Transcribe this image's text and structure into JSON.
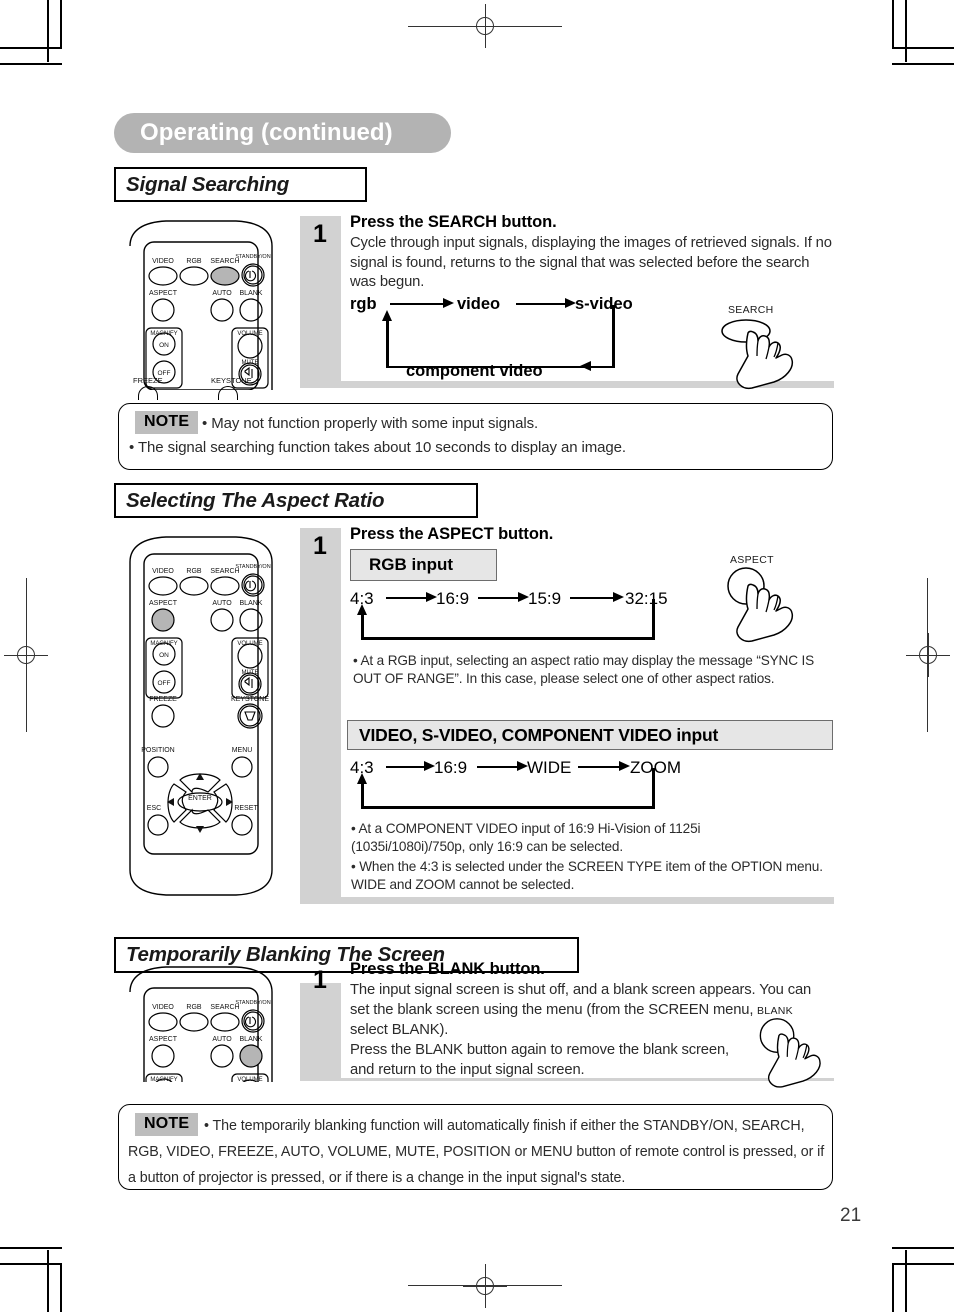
{
  "page": {
    "header_title": "Operating (continued)",
    "page_number": "21"
  },
  "sections": [
    {
      "id": "signal-searching",
      "heading": "Signal Searching",
      "step_number": "1",
      "step_title": "Press the SEARCH button.",
      "body": "Cycle through input signals, displaying the images of retrieved signals. If no signal is found, returns to the signal that was selected before the search was begun.",
      "press_icon_label": "SEARCH",
      "flow": {
        "items": [
          "rgb",
          "video",
          "s-video",
          "component video"
        ]
      },
      "note": {
        "tag": "NOTE",
        "line1": "• May not function properly with some input signals.",
        "line2": "• The signal searching function takes about 10 seconds to display an image."
      }
    },
    {
      "id": "aspect-ratio",
      "heading": "Selecting The Aspect Ratio",
      "step_number": "1",
      "step_title": "Press the ASPECT button.",
      "press_icon_label": "ASPECT",
      "banner_rgb": "RGB input",
      "flow_rgb": [
        "4:3",
        "16:9",
        "15:9",
        "32:15"
      ],
      "note_rgb": "• At a RGB input, selecting an aspect ratio may display the message “SYNC IS OUT OF RANGE”. In this case, please select one of other aspect ratios.",
      "banner_video": "VIDEO, S-VIDEO, COMPONENT VIDEO input",
      "flow_video": [
        "4:3",
        "16:9",
        "WIDE",
        "ZOOM"
      ],
      "note_video_1": "• At a COMPONENT VIDEO input of 16:9 Hi-Vision of 1125i (1035i/1080i)/750p, only 16:9 can be selected.",
      "note_video_2": "• When the 4:3 is selected under the SCREEN TYPE item of the OPTION menu. WIDE and ZOOM cannot be selected."
    },
    {
      "id": "blanking",
      "heading": "Temporarily Blanking The Screen",
      "step_number": "1",
      "step_title": "Press the BLANK button.",
      "body_line1": "The input signal screen is shut off, and a blank screen appears. You can",
      "body_line2": "set the blank screen using the menu (from the SCREEN menu,",
      "body_line3": "select BLANK).",
      "body_line4": "Press the BLANK button again to remove the blank screen,",
      "body_line5": "and return to the input signal screen.",
      "press_icon_label": "BLANK",
      "note": {
        "tag": "NOTE",
        "line1": "• The temporarily blanking function will automatically finish if either the STANDBY/ON, SEARCH,",
        "line2": "RGB, VIDEO, FREEZE, AUTO, VOLUME, MUTE, POSITION or MENU button of remote control is pressed, or if",
        "line3": "a button of projector is pressed, or if there is a change in the input signal's state."
      }
    }
  ],
  "remote": {
    "labels": {
      "video": "VIDEO",
      "rgb": "RGB",
      "search": "SEARCH",
      "standby_on": "STANDBY/ON",
      "aspect": "ASPECT",
      "auto": "AUTO",
      "blank": "BLANK",
      "magnify": "MAGNIFY",
      "on": "ON",
      "off": "OFF",
      "volume": "VOLUME",
      "mute": "MUTE",
      "freeze": "FREEZE",
      "keystone": "KEYSTONE",
      "position": "POSITION",
      "menu": "MENU",
      "enter": "ENTER",
      "esc": "ESC",
      "reset": "RESET"
    }
  },
  "colors": {
    "header_pill": "#b3b3b3",
    "gray_panel": "#d2d2d2",
    "banner_bg": "#e6e6e6",
    "note_tag_bg": "#bdbdbd",
    "highlight_button": "#b5b5b5"
  }
}
